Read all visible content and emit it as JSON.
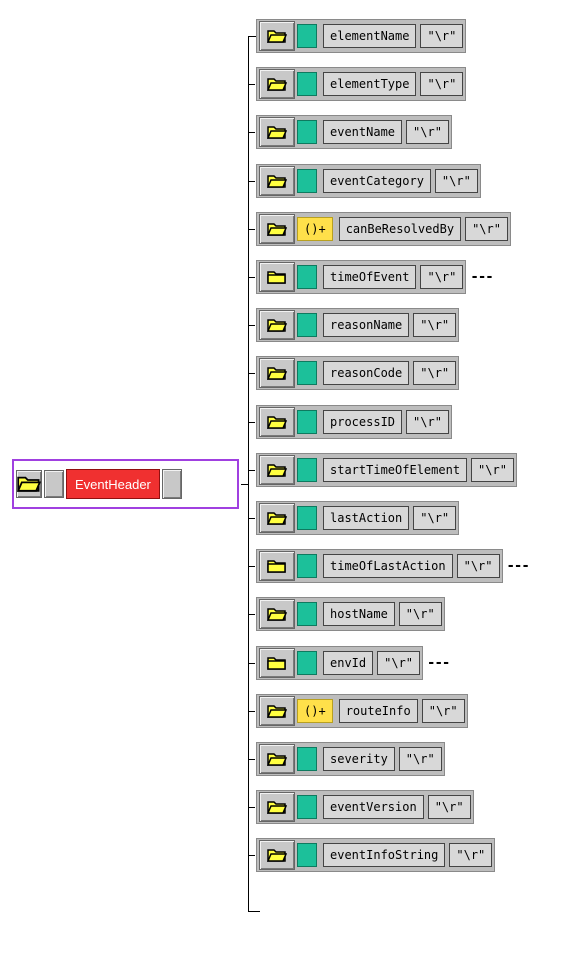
{
  "root": {
    "name": "EventHeader"
  },
  "children": [
    {
      "name": "elementName",
      "value": "\"\\r\"",
      "occurrence": "",
      "ellipsis": ""
    },
    {
      "name": "elementType",
      "value": "\"\\r\"",
      "occurrence": "",
      "ellipsis": ""
    },
    {
      "name": "eventName",
      "value": "\"\\r\"",
      "occurrence": "",
      "ellipsis": ""
    },
    {
      "name": "eventCategory",
      "value": "\"\\r\"",
      "occurrence": "",
      "ellipsis": ""
    },
    {
      "name": "canBeResolvedBy",
      "value": "\"\\r\"",
      "occurrence": "()+",
      "ellipsis": ""
    },
    {
      "name": "timeOfEvent",
      "value": "\"\\r\"",
      "occurrence": "",
      "ellipsis": "---"
    },
    {
      "name": "reasonName",
      "value": "\"\\r\"",
      "occurrence": "",
      "ellipsis": ""
    },
    {
      "name": "reasonCode",
      "value": "\"\\r\"",
      "occurrence": "",
      "ellipsis": ""
    },
    {
      "name": "processID",
      "value": "\"\\r\"",
      "occurrence": "",
      "ellipsis": ""
    },
    {
      "name": "startTimeOfElement",
      "value": "\"\\r\"",
      "occurrence": "",
      "ellipsis": ""
    },
    {
      "name": "lastAction",
      "value": "\"\\r\"",
      "occurrence": "",
      "ellipsis": ""
    },
    {
      "name": "timeOfLastAction",
      "value": "\"\\r\"",
      "occurrence": "",
      "ellipsis": "---"
    },
    {
      "name": "hostName",
      "value": "\"\\r\"",
      "occurrence": "",
      "ellipsis": ""
    },
    {
      "name": "envId",
      "value": "\"\\r\"",
      "occurrence": "",
      "ellipsis": "---"
    },
    {
      "name": "routeInfo",
      "value": "\"\\r\"",
      "occurrence": "()+",
      "ellipsis": ""
    },
    {
      "name": "severity",
      "value": "\"\\r\"",
      "occurrence": "",
      "ellipsis": ""
    },
    {
      "name": "eventVersion",
      "value": "\"\\r\"",
      "occurrence": "",
      "ellipsis": ""
    },
    {
      "name": "eventInfoString",
      "value": "\"\\r\"",
      "occurrence": "",
      "ellipsis": ""
    }
  ],
  "colors": {
    "root_name_bg": "#f03030",
    "root_frame": "#a040e0",
    "sequence_marker": "#1cc09a",
    "occurrence_marker": "#ffe04a",
    "folder_icon": "#ffff40"
  }
}
